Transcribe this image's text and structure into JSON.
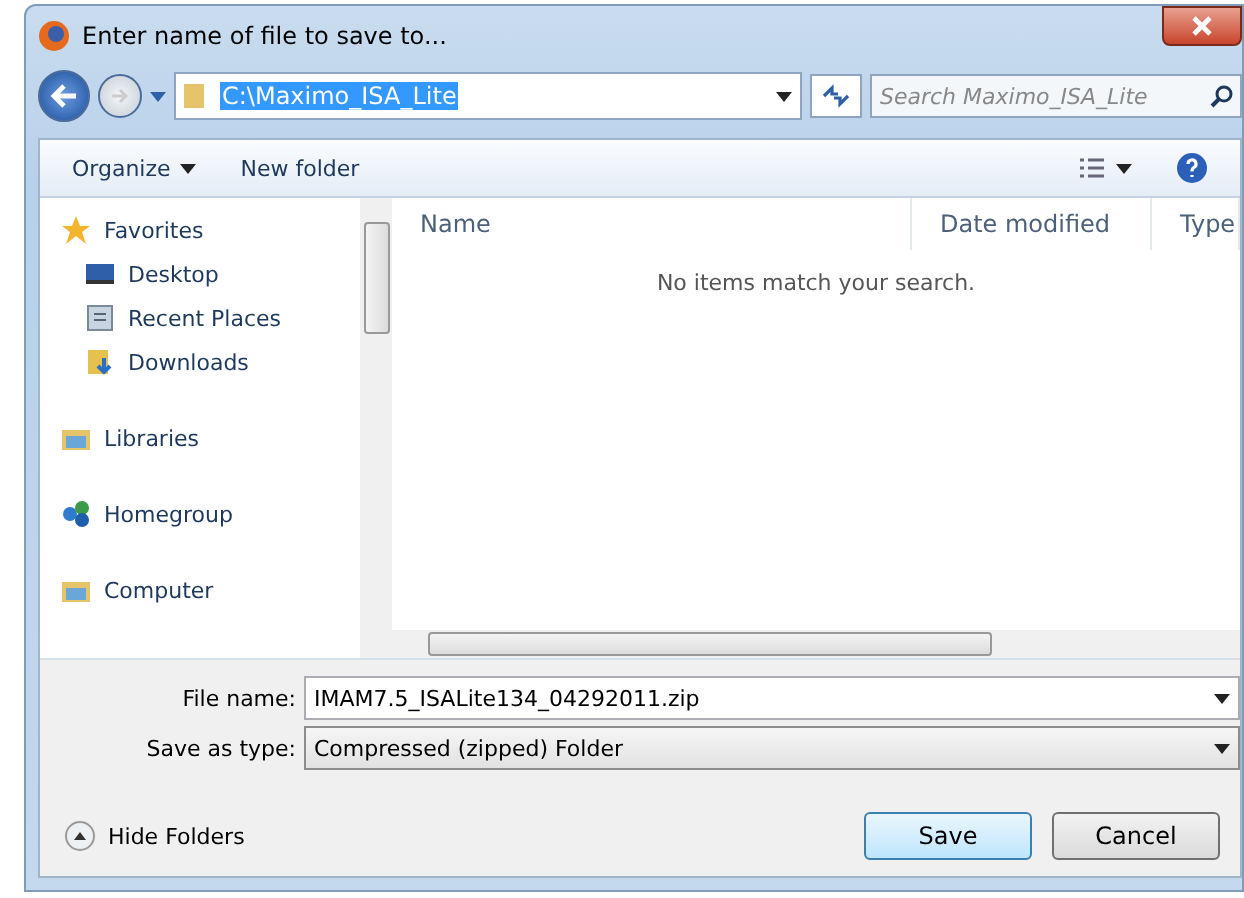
{
  "window": {
    "title": "Enter name of file to save to..."
  },
  "address": {
    "path": "C:\\Maximo_ISA_Lite",
    "selected": true
  },
  "search": {
    "placeholder": "Search Maximo_ISA_Lite"
  },
  "toolbar": {
    "organize": "Organize",
    "new_folder": "New folder"
  },
  "nav": [
    {
      "label": "Favorites",
      "kind": "favorites",
      "children": [
        {
          "label": "Desktop",
          "kind": "desktop"
        },
        {
          "label": "Recent Places",
          "kind": "recent"
        },
        {
          "label": "Downloads",
          "kind": "downloads"
        }
      ]
    },
    {
      "label": "Libraries",
      "kind": "libraries"
    },
    {
      "label": "Homegroup",
      "kind": "homegroup"
    },
    {
      "label": "Computer",
      "kind": "computer"
    }
  ],
  "table": {
    "columns": [
      "Name",
      "Date modified",
      "Type"
    ],
    "empty_message": "No items match your search."
  },
  "fields": [
    {
      "label": "File name:",
      "value": "IMAM7.5_ISALite134_04292011.zip",
      "kind": "combo"
    },
    {
      "label": "Save as type:",
      "value": "Compressed (zipped) Folder",
      "kind": "select"
    }
  ],
  "hide_folders": "Hide Folders",
  "buttons": [
    {
      "label": "Save",
      "default": true
    },
    {
      "label": "Cancel",
      "default": false
    }
  ]
}
